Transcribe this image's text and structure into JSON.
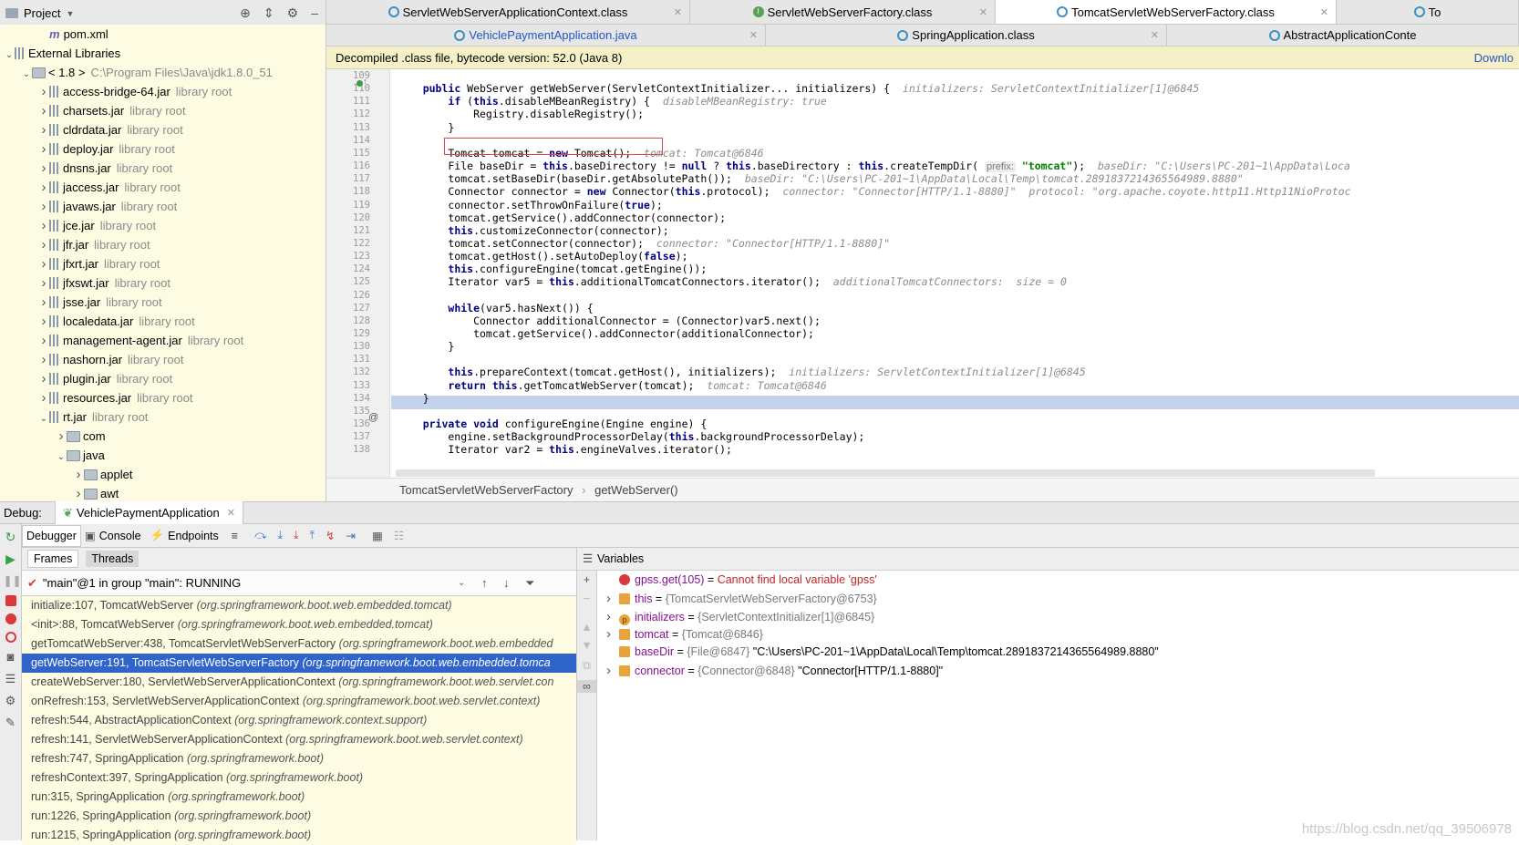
{
  "project": {
    "title": "Project",
    "tree": [
      {
        "depth": 2,
        "arrow": "",
        "icon": "pom",
        "label": "pom.xml",
        "suffix": ""
      },
      {
        "depth": 0,
        "arrow": "v",
        "icon": "lib",
        "label": "External Libraries",
        "suffix": ""
      },
      {
        "depth": 1,
        "arrow": "v",
        "icon": "folder",
        "label": "< 1.8 >",
        "suffix": "C:\\Program Files\\Java\\jdk1.8.0_51"
      },
      {
        "depth": 2,
        "arrow": ">",
        "icon": "jar",
        "label": "access-bridge-64.jar",
        "suffix": "library root"
      },
      {
        "depth": 2,
        "arrow": ">",
        "icon": "jar",
        "label": "charsets.jar",
        "suffix": "library root"
      },
      {
        "depth": 2,
        "arrow": ">",
        "icon": "jar",
        "label": "cldrdata.jar",
        "suffix": "library root"
      },
      {
        "depth": 2,
        "arrow": ">",
        "icon": "jar",
        "label": "deploy.jar",
        "suffix": "library root"
      },
      {
        "depth": 2,
        "arrow": ">",
        "icon": "jar",
        "label": "dnsns.jar",
        "suffix": "library root"
      },
      {
        "depth": 2,
        "arrow": ">",
        "icon": "jar",
        "label": "jaccess.jar",
        "suffix": "library root"
      },
      {
        "depth": 2,
        "arrow": ">",
        "icon": "jar",
        "label": "javaws.jar",
        "suffix": "library root"
      },
      {
        "depth": 2,
        "arrow": ">",
        "icon": "jar",
        "label": "jce.jar",
        "suffix": "library root"
      },
      {
        "depth": 2,
        "arrow": ">",
        "icon": "jar",
        "label": "jfr.jar",
        "suffix": "library root"
      },
      {
        "depth": 2,
        "arrow": ">",
        "icon": "jar",
        "label": "jfxrt.jar",
        "suffix": "library root"
      },
      {
        "depth": 2,
        "arrow": ">",
        "icon": "jar",
        "label": "jfxswt.jar",
        "suffix": "library root"
      },
      {
        "depth": 2,
        "arrow": ">",
        "icon": "jar",
        "label": "jsse.jar",
        "suffix": "library root"
      },
      {
        "depth": 2,
        "arrow": ">",
        "icon": "jar",
        "label": "localedata.jar",
        "suffix": "library root"
      },
      {
        "depth": 2,
        "arrow": ">",
        "icon": "jar",
        "label": "management-agent.jar",
        "suffix": "library root"
      },
      {
        "depth": 2,
        "arrow": ">",
        "icon": "jar",
        "label": "nashorn.jar",
        "suffix": "library root"
      },
      {
        "depth": 2,
        "arrow": ">",
        "icon": "jar",
        "label": "plugin.jar",
        "suffix": "library root"
      },
      {
        "depth": 2,
        "arrow": ">",
        "icon": "jar",
        "label": "resources.jar",
        "suffix": "library root"
      },
      {
        "depth": 2,
        "arrow": "v",
        "icon": "jar",
        "label": "rt.jar",
        "suffix": "library root"
      },
      {
        "depth": 3,
        "arrow": ">",
        "icon": "folder",
        "label": "com",
        "suffix": ""
      },
      {
        "depth": 3,
        "arrow": "v",
        "icon": "folder",
        "label": "java",
        "suffix": ""
      },
      {
        "depth": 4,
        "arrow": ">",
        "icon": "folder",
        "label": "applet",
        "suffix": ""
      },
      {
        "depth": 4,
        "arrow": ">",
        "icon": "folder",
        "label": "awt",
        "suffix": ""
      }
    ]
  },
  "editor": {
    "tabs_row1": [
      {
        "label": "ServletWebServerApplicationContext.class",
        "icon": "class",
        "active": false
      },
      {
        "label": "ServletWebServerFactory.class",
        "icon": "interface",
        "active": false
      },
      {
        "label": "TomcatServletWebServerFactory.class",
        "icon": "class",
        "active": true
      },
      {
        "label": "To",
        "icon": "class",
        "active": false
      }
    ],
    "tabs_row2": [
      {
        "label": "VehiclePaymentApplication.java",
        "icon": "class",
        "active": false,
        "blue": true
      },
      {
        "label": "SpringApplication.class",
        "icon": "class",
        "active": false
      },
      {
        "label": "AbstractApplicationConte",
        "icon": "class",
        "active": false
      }
    ],
    "banner": "Decompiled .class file, bytecode version: 52.0 (Java 8)",
    "banner_link": "Downlo",
    "lines": [
      {
        "n": "109",
        "html": ""
      },
      {
        "n": "110",
        "html": "    <span class=\"kw\">public</span> WebServer getWebServer(ServletContextInitializer... initializers) {  <span class=\"ann\">initializers: ServletContextInitializer[1]@6845</span>"
      },
      {
        "n": "111",
        "html": "        <span class=\"kw\">if</span> (<span class=\"kw\">this</span>.disableMBeanRegistry) {  <span class=\"ann\">disableMBeanRegistry: true</span>"
      },
      {
        "n": "112",
        "html": "            Registry.disableRegistry();"
      },
      {
        "n": "113",
        "html": "        }"
      },
      {
        "n": "114",
        "html": ""
      },
      {
        "n": "115",
        "html": "        Tomcat tomcat = <span class=\"kw\">new</span> Tomcat();  <span class=\"ann\">tomcat: Tomcat@6846</span>"
      },
      {
        "n": "116",
        "html": "        File baseDir = <span class=\"kw\">this</span>.baseDirectory != <span class=\"kw\">null</span> ? <span class=\"kw\">this</span>.baseDirectory : <span class=\"kw\">this</span>.createTempDir( <span class=\"hint\">prefix:</span> <span class=\"str\">\"tomcat\"</span>);  <span class=\"ann\">baseDir: \"C:\\Users\\PC-201~1\\AppData\\Loca</span>"
      },
      {
        "n": "117",
        "html": "        tomcat.setBaseDir(baseDir.getAbsolutePath());  <span class=\"ann\">baseDir: \"C:\\Users\\PC-201~1\\AppData\\Local\\Temp\\tomcat.2891837214365564989.8880\"</span>"
      },
      {
        "n": "118",
        "html": "        Connector connector = <span class=\"kw\">new</span> Connector(<span class=\"kw\">this</span>.protocol);  <span class=\"ann\">connector: \"Connector[HTTP/1.1-8880]\"  protocol: \"org.apache.coyote.http11.Http11NioProtoc</span>"
      },
      {
        "n": "119",
        "html": "        connector.setThrowOnFailure(<span class=\"kw\">true</span>);"
      },
      {
        "n": "120",
        "html": "        tomcat.getService().addConnector(connector);"
      },
      {
        "n": "121",
        "html": "        <span class=\"kw\">this</span>.customizeConnector(connector);"
      },
      {
        "n": "122",
        "html": "        tomcat.setConnector(connector);  <span class=\"ann\">connector: \"Connector[HTTP/1.1-8880]\"</span>"
      },
      {
        "n": "123",
        "html": "        tomcat.getHost().setAutoDeploy(<span class=\"kw\">false</span>);"
      },
      {
        "n": "124",
        "html": "        <span class=\"kw\">this</span>.configureEngine(tomcat.getEngine());"
      },
      {
        "n": "125",
        "html": "        Iterator var5 = <span class=\"kw\">this</span>.additionalTomcatConnectors.iterator();  <span class=\"ann\">additionalTomcatConnectors:  size = 0</span>"
      },
      {
        "n": "126",
        "html": ""
      },
      {
        "n": "127",
        "html": "        <span class=\"kw\">while</span>(var5.hasNext()) {"
      },
      {
        "n": "128",
        "html": "            Connector additionalConnector = (Connector)var5.next();"
      },
      {
        "n": "129",
        "html": "            tomcat.getService().addConnector(additionalConnector);"
      },
      {
        "n": "130",
        "html": "        }"
      },
      {
        "n": "131",
        "html": ""
      },
      {
        "n": "132",
        "html": "        <span class=\"kw\">this</span>.prepareContext(tomcat.getHost(), initializers);  <span class=\"ann\">initializers: ServletContextInitializer[1]@6845</span>"
      },
      {
        "n": "133",
        "html": "        <span class=\"kw\">return this</span>.getTomcatWebServer(tomcat);  <span class=\"ann\">tomcat: Tomcat@6846</span>"
      },
      {
        "n": "134",
        "html": "    }"
      },
      {
        "n": "135",
        "html": ""
      },
      {
        "n": "136",
        "html": "    <span class=\"kw\">private void</span> configureEngine(Engine engine) {"
      },
      {
        "n": "137",
        "html": "        engine.setBackgroundProcessorDelay(<span class=\"kw\">this</span>.backgroundProcessorDelay);"
      },
      {
        "n": "138",
        "html": "        Iterator var2 = <span class=\"kw\">this</span>.engineValves.iterator();"
      }
    ],
    "breadcrumb": [
      "TomcatServletWebServerFactory",
      "getWebServer()"
    ]
  },
  "debug": {
    "label": "Debug:",
    "session": "VehiclePaymentApplication",
    "tabs": [
      "Debugger",
      "Console",
      "Endpoints"
    ],
    "subtabs": [
      "Frames",
      "Threads"
    ],
    "thread": "\"main\"@1 in group \"main\": RUNNING",
    "frames": [
      {
        "m": "initialize:107, TomcatWebServer",
        "p": "(org.springframework.boot.web.embedded.tomcat)",
        "sel": false
      },
      {
        "m": "<init>:88, TomcatWebServer",
        "p": "(org.springframework.boot.web.embedded.tomcat)",
        "sel": false
      },
      {
        "m": "getTomcatWebServer:438, TomcatServletWebServerFactory",
        "p": "(org.springframework.boot.web.embedded",
        "sel": false
      },
      {
        "m": "getWebServer:191, TomcatServletWebServerFactory",
        "p": "(org.springframework.boot.web.embedded.tomca",
        "sel": true
      },
      {
        "m": "createWebServer:180, ServletWebServerApplicationContext",
        "p": "(org.springframework.boot.web.servlet.con",
        "sel": false
      },
      {
        "m": "onRefresh:153, ServletWebServerApplicationContext",
        "p": "(org.springframework.boot.web.servlet.context)",
        "sel": false
      },
      {
        "m": "refresh:544, AbstractApplicationContext",
        "p": "(org.springframework.context.support)",
        "sel": false
      },
      {
        "m": "refresh:141, ServletWebServerApplicationContext",
        "p": "(org.springframework.boot.web.servlet.context)",
        "sel": false
      },
      {
        "m": "refresh:747, SpringApplication",
        "p": "(org.springframework.boot)",
        "sel": false
      },
      {
        "m": "refreshContext:397, SpringApplication",
        "p": "(org.springframework.boot)",
        "sel": false
      },
      {
        "m": "run:315, SpringApplication",
        "p": "(org.springframework.boot)",
        "sel": false
      },
      {
        "m": "run:1226, SpringApplication",
        "p": "(org.springframework.boot)",
        "sel": false
      },
      {
        "m": "run:1215, SpringApplication",
        "p": "(org.springframework.boot)",
        "sel": false
      }
    ],
    "vars_title": "Variables",
    "vars": [
      {
        "arrow": "",
        "icon": "error",
        "name": "gpss.get(105)",
        "eq": " = ",
        "type": "",
        "val": "Cannot find local variable 'gpss'",
        "err": true
      },
      {
        "arrow": ">",
        "icon": "field",
        "name": "this",
        "eq": " = ",
        "type": "{TomcatServletWebServerFactory@6753}",
        "val": "",
        "err": false
      },
      {
        "arrow": ">",
        "icon": "param",
        "name": "initializers",
        "eq": " = ",
        "type": "{ServletContextInitializer[1]@6845}",
        "val": "",
        "err": false
      },
      {
        "arrow": ">",
        "icon": "field",
        "name": "tomcat",
        "eq": " = ",
        "type": "{Tomcat@6846}",
        "val": "",
        "err": false
      },
      {
        "arrow": "",
        "icon": "field",
        "name": "baseDir",
        "eq": " = ",
        "type": "{File@6847}",
        "val": " \"C:\\Users\\PC-201~1\\AppData\\Local\\Temp\\tomcat.2891837214365564989.8880\"",
        "err": false
      },
      {
        "arrow": ">",
        "icon": "field",
        "name": "connector",
        "eq": " = ",
        "type": "{Connector@6848}",
        "val": " \"Connector[HTTP/1.1-8880]\"",
        "err": false
      }
    ],
    "watermark": "https://blog.csdn.net/qq_39506978"
  }
}
